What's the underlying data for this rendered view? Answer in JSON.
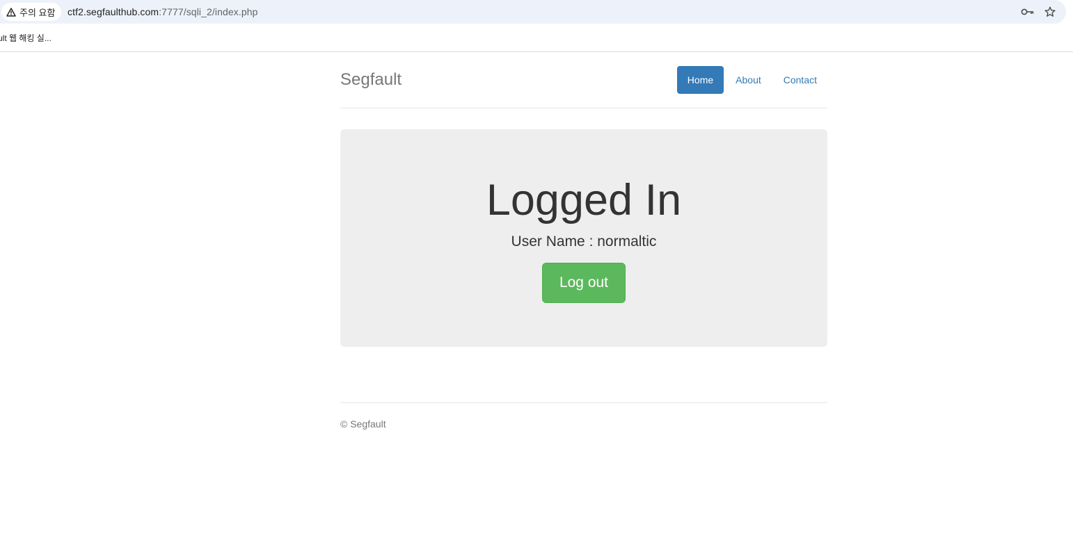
{
  "browser": {
    "security_chip_label": "주의 요함",
    "url_host": "ctf2.segfaulthub.com",
    "url_path": ":7777/sqli_2/index.php",
    "icons": {
      "security": "warning-triangle-icon",
      "passwords": "key-icon",
      "bookmark": "star-icon"
    },
    "bookmark_label": "ult 웹 해킹 실..."
  },
  "header": {
    "brand": "Segfault",
    "nav": [
      {
        "label": "Home",
        "active": true
      },
      {
        "label": "About",
        "active": false
      },
      {
        "label": "Contact",
        "active": false
      }
    ]
  },
  "jumbotron": {
    "title": "Logged In",
    "subtitle": "User Name : normaltic",
    "button_label": "Log out"
  },
  "footer": {
    "text": "© Segfault"
  },
  "colors": {
    "primary": "#337ab7",
    "success": "#5cb85c",
    "jumbotron_bg": "#eeeeee",
    "omnibox_bg": "#edf2fa"
  }
}
